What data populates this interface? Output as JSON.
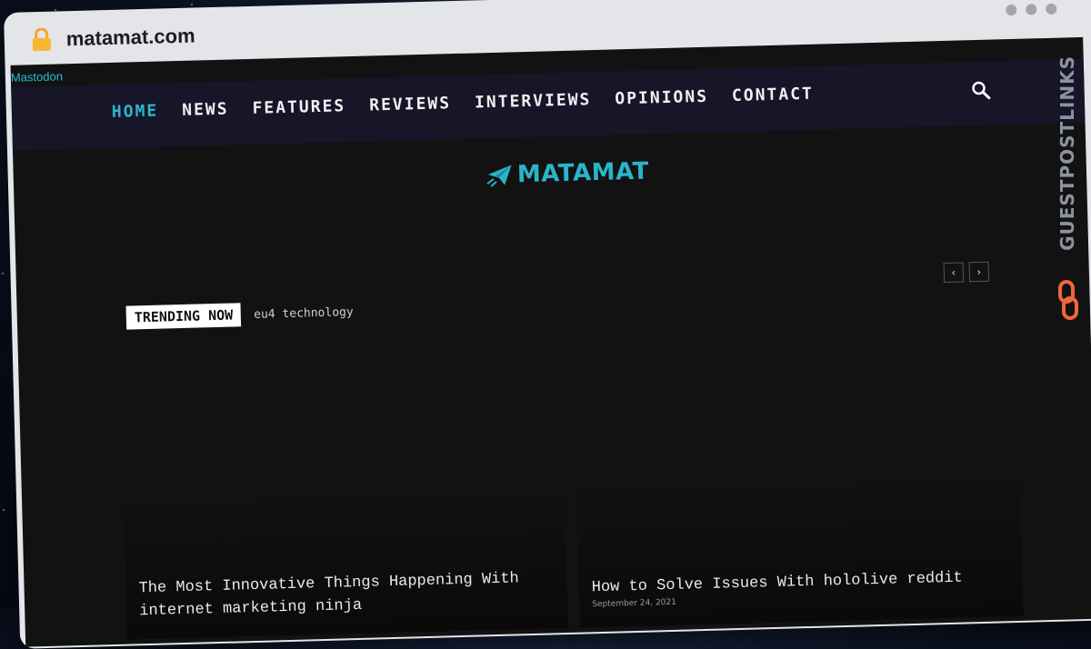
{
  "browser": {
    "url": "matamat.com"
  },
  "page": {
    "top_link": "Mastodon",
    "nav": [
      {
        "label": "HOME",
        "active": true
      },
      {
        "label": "NEWS"
      },
      {
        "label": "FEATURES"
      },
      {
        "label": "REVIEWS"
      },
      {
        "label": "INTERVIEWS"
      },
      {
        "label": "OPINIONS"
      },
      {
        "label": "CONTACT"
      }
    ],
    "logo_text": "MATAMAT",
    "trending": {
      "badge": "TRENDING NOW",
      "headline": "eu4 technology"
    },
    "slider": {
      "prev": "‹",
      "next": "›"
    },
    "cards": [
      {
        "title": "The Most Innovative Things Happening With internet marketing ninja"
      },
      {
        "title": "How to Solve Issues With hololive reddit",
        "meta": "September 24, 2021"
      }
    ]
  },
  "side_brand": "GUESTPOSTLINKS",
  "colors": {
    "accent": "#2bb8cc",
    "nav_bg": "#171528",
    "page_bg": "#121212",
    "brand_orange": "#f0663c"
  },
  "icons": [
    "lock-icon",
    "search-icon",
    "paper-plane-icon",
    "chain-link-icon"
  ]
}
